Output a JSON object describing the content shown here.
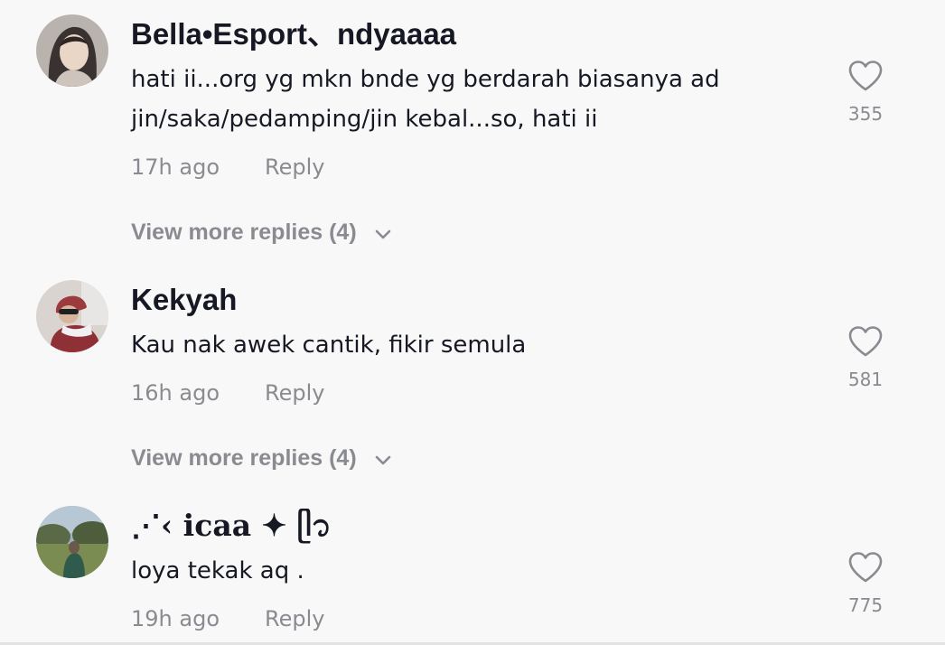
{
  "comments": [
    {
      "username": "Bella•Esport、ndyaaaa",
      "text": "hati ii...org yg mkn bnde yg berdarah biasanya ad jin/saka/pedamping/jin kebal...so, hati ii",
      "time": "17h ago",
      "reply_label": "Reply",
      "likes": "355",
      "view_more": "View more replies (4)"
    },
    {
      "username": "Kekyah",
      "text": "Kau nak awek cantik, fikir semula",
      "time": "16h ago",
      "reply_label": "Reply",
      "likes": "581",
      "view_more": "View more replies (4)"
    },
    {
      "username": "⋰‹ icaa ✦ ᥫ᭡",
      "text": "loya tekak aq .",
      "time": "19h ago",
      "reply_label": "Reply",
      "likes": "775"
    }
  ],
  "icons": {
    "like": "heart-outline-icon",
    "expand": "chevron-down-icon"
  },
  "colors": {
    "background": "#f8f8f8",
    "primary_text": "#161823",
    "secondary_text": "#8a8b91"
  }
}
